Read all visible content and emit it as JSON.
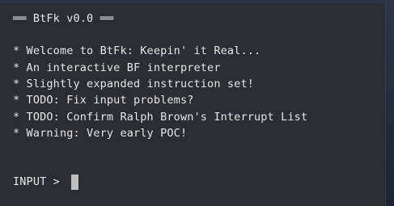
{
  "terminal": {
    "title": "══ BtFk v0.0 ══",
    "lines": [
      "* Welcome to BtFk: Keepin' it Real...",
      "* An interactive BF interpreter",
      "* Slightly expanded instruction set!",
      "* TODO: Fix input problems?",
      "* TODO: Confirm Ralph Brown's Interrupt List",
      "* Warning: Very early POC!"
    ],
    "prompt": "INPUT > "
  },
  "colors": {
    "background": "#2b2d33",
    "text": "#e6e6e6",
    "cursor": "#bdbdbd"
  }
}
